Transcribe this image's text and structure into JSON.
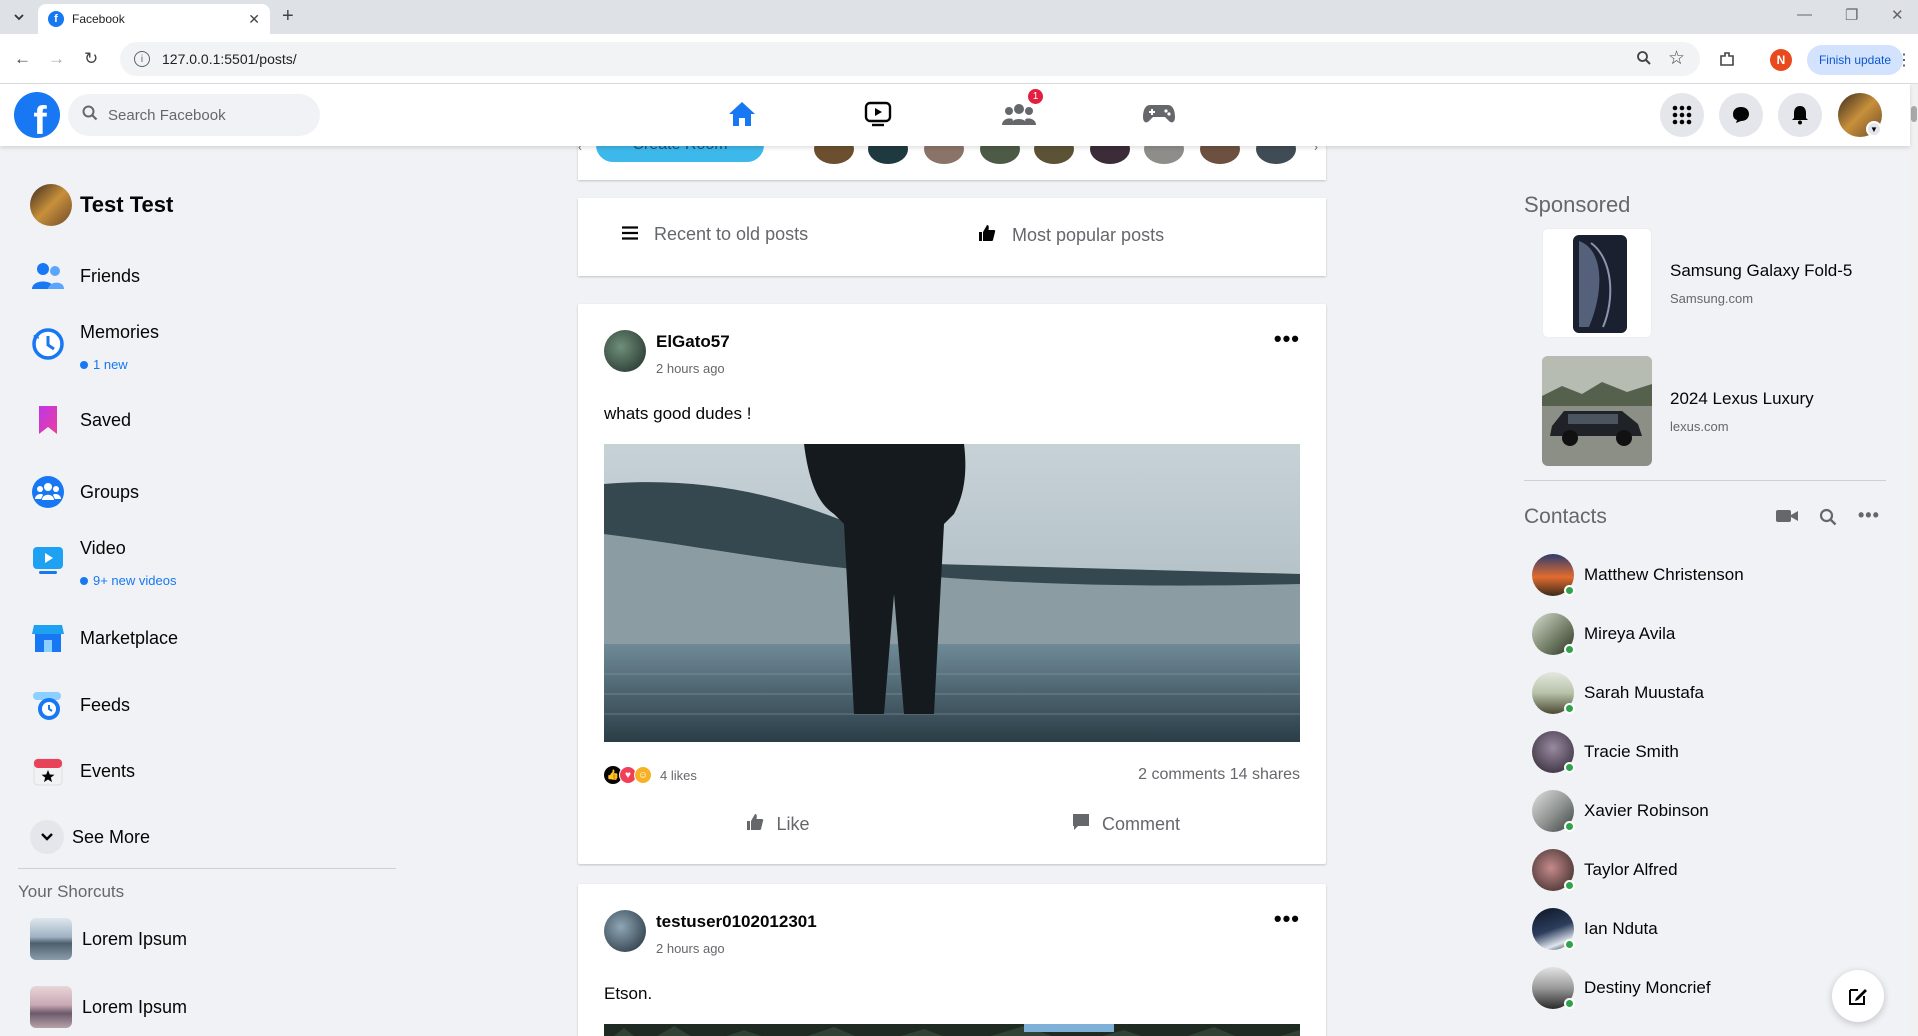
{
  "browser": {
    "tab_title": "Facebook",
    "url": "127.0.0.1:5501/posts/",
    "profile_initial": "N",
    "finish_update": "Finish update"
  },
  "header": {
    "logo": "f",
    "search_placeholder": "Search Facebook",
    "friends_badge": "1"
  },
  "left_sidebar": {
    "user_name": "Test Test",
    "items": [
      {
        "label": "Friends",
        "icon": "friends-icon"
      },
      {
        "label": "Memories",
        "icon": "memories-icon",
        "sub": "1 new"
      },
      {
        "label": "Saved",
        "icon": "saved-icon"
      },
      {
        "label": "Groups",
        "icon": "groups-icon"
      },
      {
        "label": "Video",
        "icon": "video-icon",
        "sub": "9+ new videos"
      },
      {
        "label": "Marketplace",
        "icon": "marketplace-icon"
      },
      {
        "label": "Feeds",
        "icon": "feeds-icon"
      },
      {
        "label": "Events",
        "icon": "events-icon"
      }
    ],
    "see_more": "See More",
    "shortcuts_title": "Your Shorcuts",
    "shortcuts": [
      "Lorem Ipsum",
      "Lorem Ipsum"
    ]
  },
  "stories": {
    "create_room": "Create Room"
  },
  "sort": {
    "recent": "Recent to old posts",
    "popular": "Most popular posts"
  },
  "posts": [
    {
      "author": "ElGato57",
      "time": "2 hours ago",
      "text": "whats good dudes !",
      "likes": "4 likes",
      "stats": "2 comments 14 shares",
      "like_label": "Like",
      "comment_label": "Comment"
    },
    {
      "author": "testuser0102012301",
      "time": "2 hours ago",
      "text": "Etson."
    }
  ],
  "sponsored": {
    "title": "Sponsored",
    "ads": [
      {
        "title": "Samsung Galaxy Fold-5",
        "url": "Samsung.com"
      },
      {
        "title": "2024 Lexus Luxury",
        "url": "lexus.com"
      }
    ]
  },
  "contacts": {
    "title": "Contacts",
    "people": [
      "Matthew Christenson",
      "Mireya Avila",
      "Sarah Muustafa",
      "Tracie Smith",
      "Xavier Robinson",
      "Taylor Alfred",
      "Ian Nduta",
      "Destiny Moncrief"
    ]
  },
  "colors": {
    "brand_blue": "#1877f2",
    "online_green": "#31a24c",
    "badge_red": "#e41e3f"
  }
}
